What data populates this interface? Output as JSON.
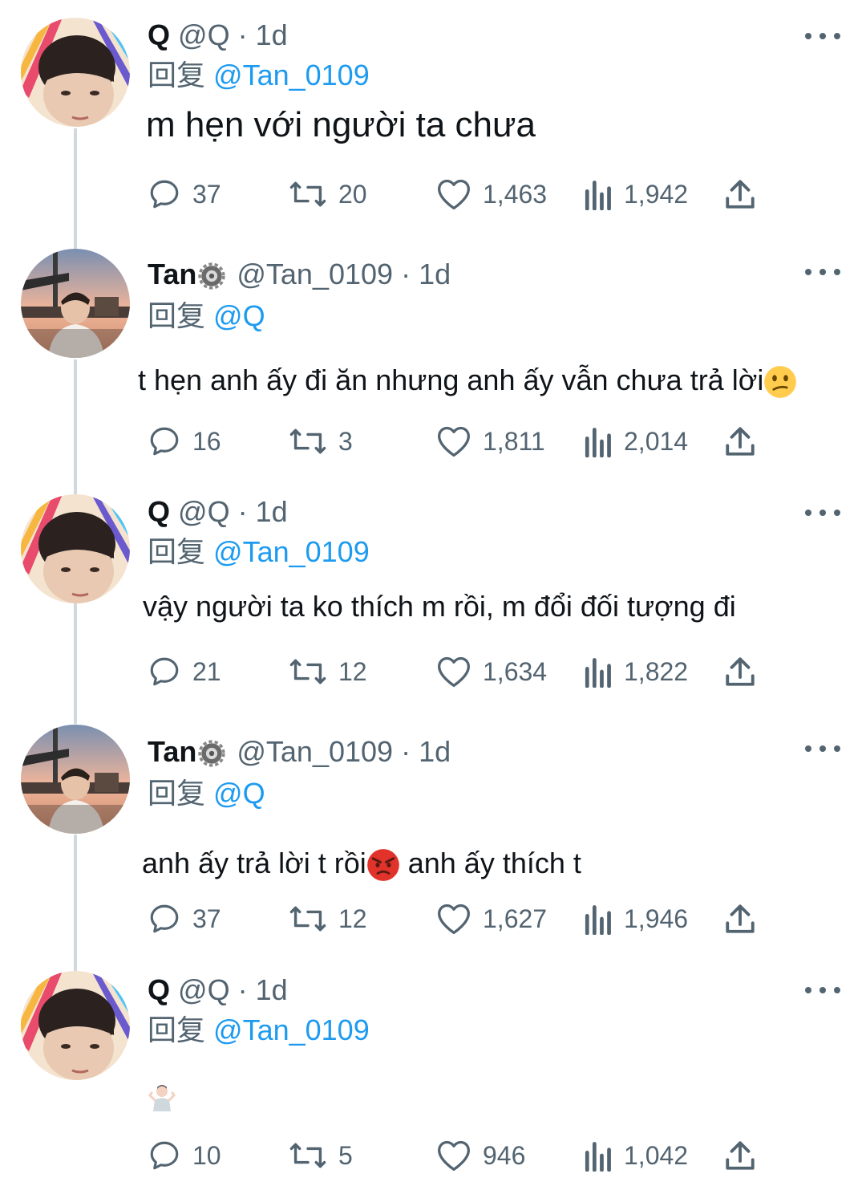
{
  "reply_prefix": "回复",
  "tweets": [
    {
      "name": "Q",
      "handle": "@Q",
      "sep": "·",
      "time": "1d",
      "reply_to": "@Tan_0109",
      "text": "m hẹn với người ta chưa",
      "replies": "37",
      "retweets": "20",
      "likes": "1,463",
      "views": "1,942"
    },
    {
      "name": "Tan",
      "handle": "@Tan_0109",
      "sep": "·",
      "time": "1d",
      "reply_to": "@Q",
      "text": "t hẹn anh ấy đi ăn nhưng anh ấy vẫn chưa trả lời",
      "emoji": "confused-face",
      "replies": "16",
      "retweets": "3",
      "likes": "1,811",
      "views": "2,014"
    },
    {
      "name": "Q",
      "handle": "@Q",
      "sep": "·",
      "time": "1d",
      "reply_to": "@Tan_0109",
      "text": "vậy người ta ko thích m rồi, m đổi đối tượng đi",
      "replies": "21",
      "retweets": "12",
      "likes": "1,634",
      "views": "1,822"
    },
    {
      "name": "Tan",
      "handle": "@Tan_0109",
      "sep": "·",
      "time": "1d",
      "reply_to": "@Q",
      "text_a": "anh ấy trả lời t rồi",
      "emoji": "angry-face",
      "text_b": " anh ấy thích t",
      "replies": "37",
      "retweets": "12",
      "likes": "1,627",
      "views": "1,946"
    },
    {
      "name": "Q",
      "handle": "@Q",
      "sep": "·",
      "time": "1d",
      "reply_to": "@Tan_0109",
      "emoji": "person-shrugging",
      "replies": "10",
      "retweets": "5",
      "likes": "946",
      "views": "1,042"
    }
  ],
  "colors": {
    "accent": "#1d9bf0",
    "secondary_text": "#536471",
    "thread_line": "#cfd9de"
  }
}
